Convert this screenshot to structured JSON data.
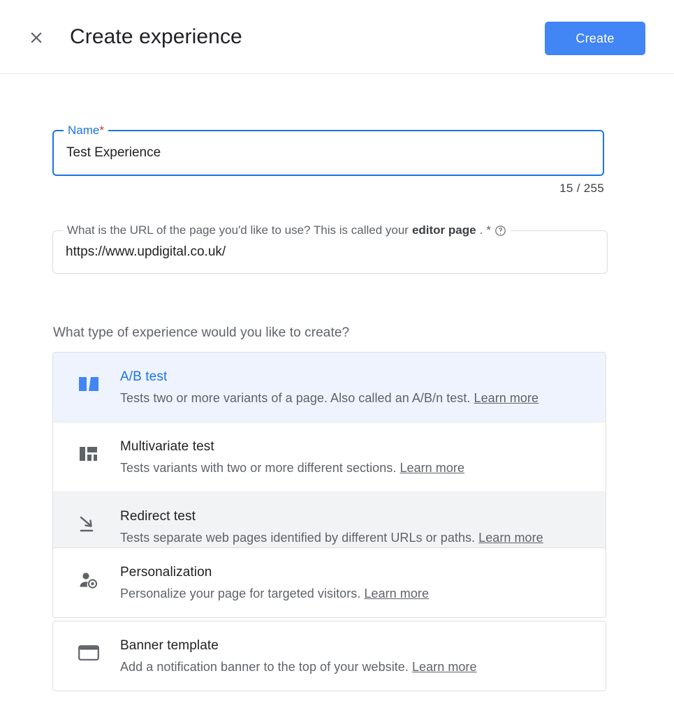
{
  "header": {
    "close_icon": "close-icon",
    "title": "Create experience",
    "create_label": "Create",
    "accent_color": "#4285f4"
  },
  "form": {
    "name": {
      "label": "Name",
      "required_marker": "*",
      "value": "Test Experience",
      "placeholder": "",
      "counter": "15 / 255",
      "focus_color": "#1a73e8",
      "required_color": "#d93025"
    },
    "url": {
      "label_part1": "What is the URL of the page you'd like to use? This is called your ",
      "label_strong": "editor page",
      "label_part2": ". ",
      "required_marker": "*",
      "help_icon": "help-circle-icon",
      "value": "https://www.updigital.co.uk/",
      "placeholder": ""
    }
  },
  "type_section": {
    "question": "What type of experience would you like to create?",
    "options": [
      {
        "id": "ab-test",
        "icon": "ab-test-icon",
        "title": "A/B test",
        "description": "Tests two or more variants of a page. Also called an A/B/n test.",
        "learn_more": "Learn more",
        "state": "selected",
        "selected_bg": "#eef3fd",
        "selected_text": "#1a73e8"
      },
      {
        "id": "multivariate-test",
        "icon": "multivariate-test-icon",
        "title": "Multivariate test",
        "description": "Tests variants with two or more different sections.",
        "learn_more": "Learn more",
        "state": "default"
      },
      {
        "id": "redirect-test",
        "icon": "redirect-test-icon",
        "title": "Redirect test",
        "description": "Tests separate web pages identified by different URLs or paths.",
        "learn_more": "Learn more",
        "state": "hovered",
        "hover_bg": "#f1f3f4"
      },
      {
        "id": "personalization",
        "icon": "personalization-icon",
        "title": "Personalization",
        "description": "Personalize your page for targeted visitors.",
        "learn_more": "Learn more",
        "state": "default"
      },
      {
        "id": "banner-template",
        "icon": "banner-template-icon",
        "title": "Banner template",
        "description": "Add a notification banner to the top of your website.",
        "learn_more": "Learn more",
        "state": "default"
      }
    ]
  }
}
